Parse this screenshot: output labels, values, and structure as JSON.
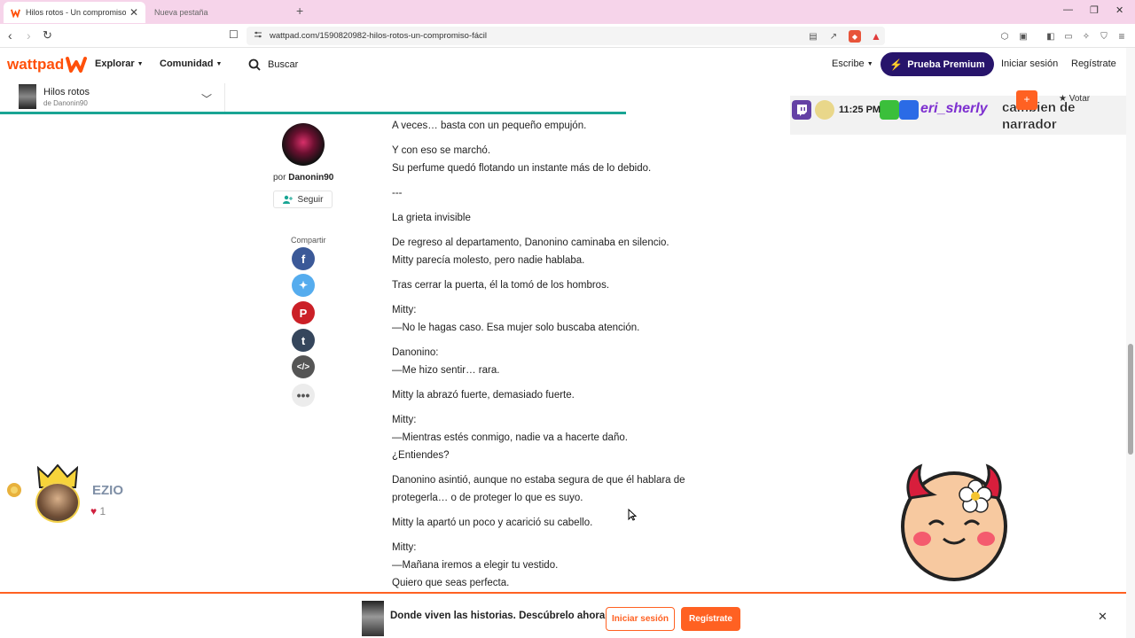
{
  "browser": {
    "tabs": [
      {
        "label": "Hilos rotos - Un compromiso fácil"
      },
      {
        "label": "Nueva pestaña"
      }
    ],
    "url": "wattpad.com/1590820982-hilos-rotos-un-compromiso-fácil"
  },
  "header": {
    "logo_text": "wattpad",
    "explorar": "Explorar",
    "comunidad": "Comunidad",
    "search_label": "Buscar",
    "escribe": "Escribe",
    "premium": "Prueba Premium",
    "login": "Iniciar sesión",
    "register": "Regístrate"
  },
  "story": {
    "title": "Hilos rotos",
    "author_line": "de Danonin90",
    "progress_percent": 55
  },
  "author": {
    "por": "por",
    "name": "Danonin90",
    "follow": "Seguir",
    "share_label": "Compartir"
  },
  "overlay": {
    "time": "11:25 PM",
    "username": "eri_sherly",
    "message": "cambien de narrador",
    "votar": "Votar"
  },
  "paragraphs": [
    [
      "A veces… basta con un pequeño empujón."
    ],
    [
      "Y con eso se marchó.",
      "Su perfume quedó flotando un instante más de lo debido."
    ],
    [
      "---"
    ],
    [
      "La grieta invisible"
    ],
    [
      "De regreso al departamento, Danonino caminaba en silencio.",
      "Mitty parecía molesto, pero nadie hablaba."
    ],
    [
      "Tras cerrar la puerta, él la tomó de los hombros."
    ],
    [
      "Mitty:",
      "—No le hagas caso. Esa mujer solo buscaba atención."
    ],
    [
      "Danonino:",
      "—Me hizo sentir… rara."
    ],
    [
      "Mitty la abrazó fuerte, demasiado fuerte."
    ],
    [
      "Mitty:",
      "—Mientras estés conmigo, nadie va a hacerte daño.",
      "¿Entiendes?"
    ],
    [
      "Danonino asintió, aunque no estaba segura de que él hablara de",
      "protegerla… o de proteger lo que es suyo."
    ],
    [
      "Mitty la apartó un poco y acarició su cabello."
    ],
    [
      "Mitty:",
      "—Mañana iremos a elegir tu vestido.",
      "Quiero que seas perfecta."
    ]
  ],
  "bottom_bar": {
    "text": "Donde viven las historias. Descúbrelo ahora",
    "login": "Iniciar sesión",
    "register": "Regístrate"
  },
  "widget": {
    "name": "EZIO",
    "count": "1"
  },
  "colors": {
    "brand": "#ff500a",
    "premium_bg": "#27146b",
    "progress": "#19a594",
    "tabbar": "#f6d4ea"
  }
}
